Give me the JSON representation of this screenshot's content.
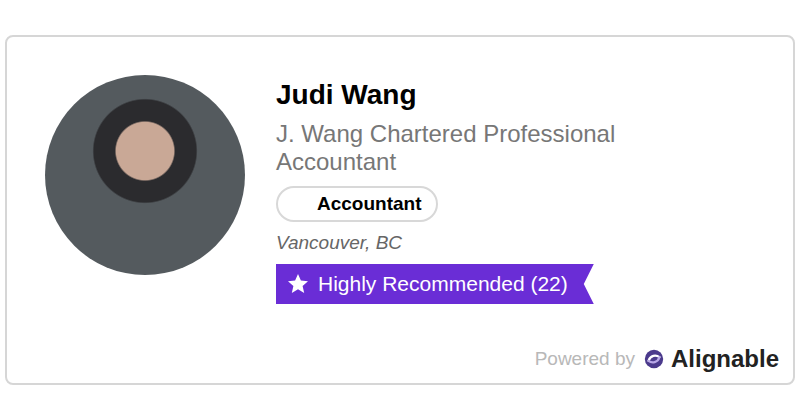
{
  "profile": {
    "name": "Judi Wang",
    "company": "J. Wang Chartered Professional Accountant",
    "category": "Accountant",
    "location": "Vancouver, BC",
    "badge": "Highly Recommended (22)"
  },
  "footer": {
    "powered_by": "Powered by",
    "brand": "Alignable"
  }
}
